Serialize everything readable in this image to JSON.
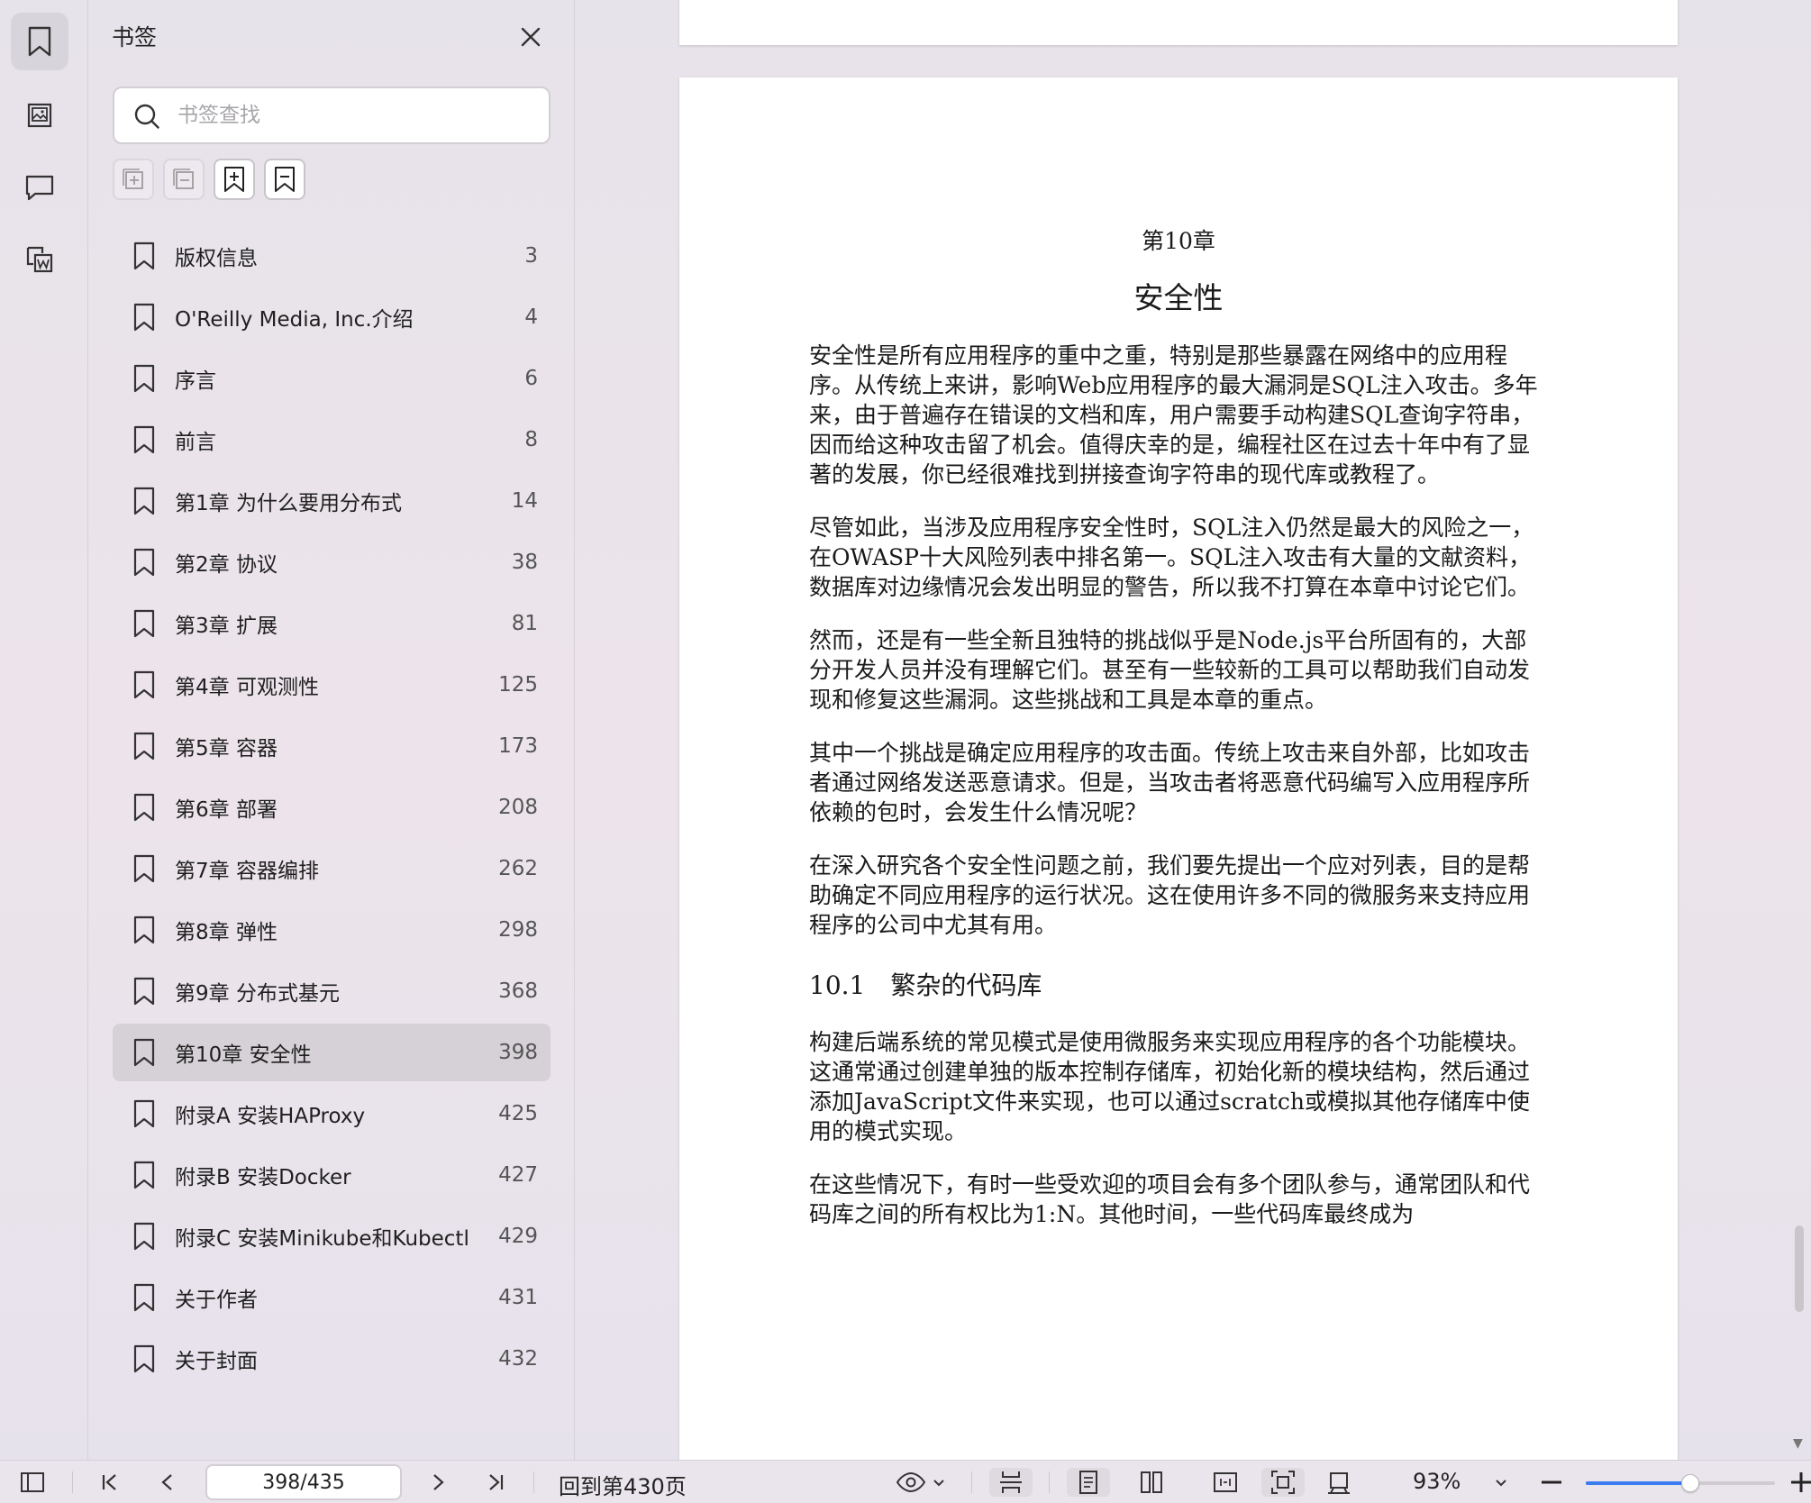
{
  "panel": {
    "title": "书签",
    "search_placeholder": "书签查找"
  },
  "bookmarks": [
    {
      "label": "版权信息",
      "page": "3"
    },
    {
      "label": "O'Reilly Media, Inc.介绍",
      "page": "4"
    },
    {
      "label": "序言",
      "page": "6"
    },
    {
      "label": "前言",
      "page": "8"
    },
    {
      "label": "第1章 为什么要用分布式",
      "page": "14"
    },
    {
      "label": "第2章 协议",
      "page": "38"
    },
    {
      "label": "第3章 扩展",
      "page": "81"
    },
    {
      "label": "第4章 可观测性",
      "page": "125"
    },
    {
      "label": "第5章 容器",
      "page": "173"
    },
    {
      "label": "第6章 部署",
      "page": "208"
    },
    {
      "label": "第7章 容器编排",
      "page": "262"
    },
    {
      "label": "第8章 弹性",
      "page": "298"
    },
    {
      "label": "第9章 分布式基元",
      "page": "368"
    },
    {
      "label": "第10章 安全性",
      "page": "398"
    },
    {
      "label": "附录A 安装HAProxy",
      "page": "425"
    },
    {
      "label": "附录B 安装Docker",
      "page": "427"
    },
    {
      "label": "附录C 安装Minikube和Kubectl",
      "page": "429"
    },
    {
      "label": "关于作者",
      "page": "431"
    },
    {
      "label": "关于封面",
      "page": "432"
    }
  ],
  "selected_index": 13,
  "document": {
    "chapter_number": "第10章",
    "chapter_title": "安全性",
    "para1": "安全性是所有应用程序的重中之重，特别是那些暴露在网络中的应用程序。从传统上来讲，影响Web应用程序的最大漏洞是SQL注入攻击。多年来，由于普遍存在错误的文档和库，用户需要手动构建SQL查询字符串，因而给这种攻击留了机会。值得庆幸的是，编程社区在过去十年中有了显著的发展，你已经很难找到拼接查询字符串的现代库或教程了。",
    "para2": "尽管如此，当涉及应用程序安全性时，SQL注入仍然是最大的风险之一，在OWASP十大风险列表中排名第一。SQL注入攻击有大量的文献资料，数据库对边缘情况会发出明显的警告，所以我不打算在本章中讨论它们。",
    "para3": "然而，还是有一些全新且独特的挑战似乎是Node.js平台所固有的，大部分开发人员并没有理解它们。甚至有一些较新的工具可以帮助我们自动发现和修复这些漏洞。这些挑战和工具是本章的重点。",
    "para4": "其中一个挑战是确定应用程序的攻击面。传统上攻击来自外部，比如攻击者通过网络发送恶意请求。但是，当攻击者将恶意代码编写入应用程序所依赖的包时，会发生什么情况呢？",
    "para5": "在深入研究各个安全性问题之前，我们要先提出一个应对列表，目的是帮助确定不同应用程序的运行状况。这在使用许多不同的微服务来支持应用程序的公司中尤其有用。",
    "section_heading": "10.1　繁杂的代码库",
    "para6": "构建后端系统的常见模式是使用微服务来实现应用程序的各个功能模块。这通常通过创建单独的版本控制存储库，初始化新的模块结构，然后通过添加JavaScript文件来实现，也可以通过scratch或模拟其他存储库中使用的模式实现。",
    "para7": "在这些情况下，有时一些受欢迎的项目会有多个团队参与，通常团队和代码库之间的所有权比为1:N。其他时间，一些代码库最终成为"
  },
  "toolbar": {
    "page_value": "398/435",
    "goto_label": "回到第430页",
    "zoom_label": "93%",
    "zoom_fraction": 0.55
  },
  "colors": {
    "accent": "#3b7cf0",
    "selected_row": "#d6d1d6"
  }
}
